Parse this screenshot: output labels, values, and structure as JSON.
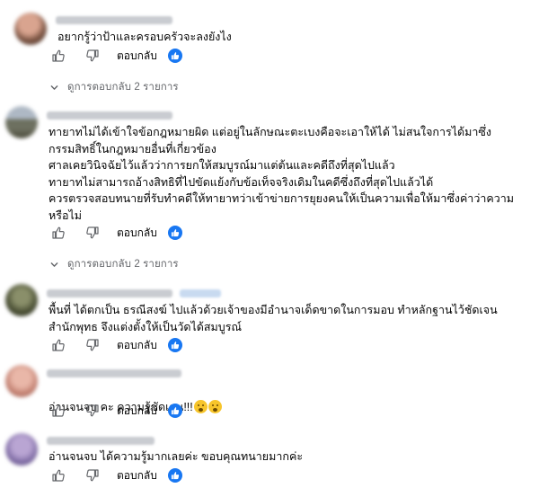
{
  "actions": {
    "reply_label": "ตอบกลับ"
  },
  "comments": [
    {
      "text": "อยากรู้ว่าป้าและครอบครัวจะลงยังไง",
      "view_replies": "ดูการตอบกลับ 2 รายการ"
    },
    {
      "text": "ทายาทไม่ได้เข้าใจข้อกฎหมายผิด แต่อยู่ในลักษณะตะเบงคือจะเอาให้ได้ ไม่สนใจการได้มาซึ่ง\nกรรมสิทธิ์ในกฎหมายอื่นที่เกี่ยวข้อง\nศาลเคยวินิจฉัยไว้แล้วว่าการยกให้สมบูรณ์มาแต่ต้นและคดีถึงที่สุดไปแล้ว\nทายาทไม่สามารถอ้างสิทธิที่ไปขัดแย้งกับข้อเท็จจริงเดิมในคดีซึ่งถึงที่สุดไปแล้วได้\nควรตรวจสอบทนายที่รับทำคดีให้ทายาทว่าเข้าข่ายการยุยงคนให้เป็นความเพื่อให้มาซึ่งค่าว่าความ\nหรือไม่",
      "view_replies": "ดูการตอบกลับ 2 รายการ"
    },
    {
      "text": "พื้นที่ ได้ตกเป็น ธรณีสงฆ์ ไปแล้วด้วยเจ้าของมีอำนาจเด็ดขาดในการมอบ ทำหลักฐานไว้ชัดเจน\nสำนักพุทธ จึงแต่งตั้งให้เป็นวัดได้สมบูรณ์"
    },
    {
      "text": "อ่านจนจบ คะ ความรู้ชัดเจน!!!"
    },
    {
      "text": "อ่านจนจบ ได้ความรู้มากเลยค่ะ ขอบคุณทนายมากค่ะ"
    }
  ],
  "icons": [
    "like-icon",
    "dislike-icon",
    "reaction-like-icon",
    "chevron-down-icon",
    "avatar",
    "emoji-icon"
  ],
  "colors": {
    "accent": "#1877f2",
    "muted_text": "#65676b"
  }
}
